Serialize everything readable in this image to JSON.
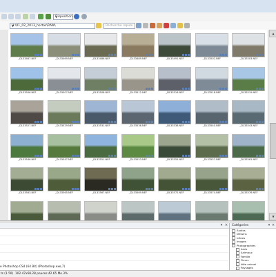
{
  "toolbar1": {
    "layout_label": "Disposition",
    "buttons": [
      "back-icon",
      "forward-icon",
      "up-icon",
      "refresh-icon",
      "folder-up-icon",
      "favorites-icon",
      "layout-icon",
      "help-icon",
      "info-icon"
    ]
  },
  "toolbar2": {
    "path": "H:\\01_02_2013_hortas\\RAW\\",
    "search_placeholder": "Recherche rapide"
  },
  "thumbnails": [
    {
      "label": "_DL33467.NEF",
      "c1": "#5f7d4a",
      "c2": "#a5c3e6"
    },
    {
      "label": "_DL33469.NEF",
      "c1": "#8b8f7a",
      "c2": "#d7dde4"
    },
    {
      "label": "_DL33486.NEF",
      "c1": "#6a6b52",
      "c2": "#e6e8ea"
    },
    {
      "label": "_DL33489.NEF",
      "c1": "#8a7a60",
      "c2": "#b8ad95"
    },
    {
      "label": "_DL33491.NEF",
      "c1": "#3e4a3a",
      "c2": "#b9c3c8"
    },
    {
      "label": "_DL33502.NEF",
      "c1": "#7d8a95",
      "c2": "#d8dfe6"
    },
    {
      "label": "_DL33503.NEF",
      "c1": "#7f7a6a",
      "c2": "#dfe2e5"
    },
    {
      "label": "_DL33506.NEF",
      "c1": "#4d6b3a",
      "c2": "#9fc2e8"
    },
    {
      "label": "_DL33507.NEF",
      "c1": "#8a8f95",
      "c2": "#e3e7eb"
    },
    {
      "label": "_DL33508.NEF",
      "c1": "#6e7f63",
      "c2": "#c5ced6"
    },
    {
      "label": "_DL33512.NEF",
      "c1": "#9a958a",
      "c2": "#dcdcd6"
    },
    {
      "label": "_DL33516.NEF",
      "c1": "#5d6068",
      "c2": "#b7bfca"
    },
    {
      "label": "_DL33518.NEF",
      "c1": "#7f8b96",
      "c2": "#d1d9e1"
    },
    {
      "label": "_DL33519.NEF",
      "c1": "#5a7d48",
      "c2": "#a8c6e6"
    },
    {
      "label": "_DL33527.NEF",
      "c1": "#4f4a45",
      "c2": "#a9a39a"
    },
    {
      "label": "_DL33529.NEF",
      "c1": "#6b7a5a",
      "c2": "#c4ccc0"
    },
    {
      "label": "_DL33531.NEF",
      "c1": "#4a5a6a",
      "c2": "#9eb6d3"
    },
    {
      "label": "_DL33536.NEF",
      "c1": "#5b6670",
      "c2": "#b8c6d6"
    },
    {
      "label": "_DL33538.NEF",
      "c1": "#3f5a78",
      "c2": "#8eb0d8"
    },
    {
      "label": "_DL33540.NEF",
      "c1": "#58646e",
      "c2": "#b0bdc9"
    },
    {
      "label": "_DL33543.NEF",
      "c1": "#596a72",
      "c2": "#a8b8c5"
    },
    {
      "label": "_DL33546.NEF",
      "c1": "#4c7a3e",
      "c2": "#8eb0d0"
    },
    {
      "label": "_DL33547.NEF",
      "c1": "#567a3d",
      "c2": "#a6c0a0"
    },
    {
      "label": "_DL33551.NEF",
      "c1": "#4a6a3f",
      "c2": "#8fb5de"
    },
    {
      "label": "_DL33553.NEF",
      "c1": "#5c8a42",
      "c2": "#a9c989"
    },
    {
      "label": "_DL33555.NEF",
      "c1": "#3a4a38",
      "c2": "#9ca58e"
    },
    {
      "label": "_DL33557.NEF",
      "c1": "#5b6b4c",
      "c2": "#b3c0a5"
    },
    {
      "label": "_DL33561.NEF",
      "c1": "#4a6a48",
      "c2": "#9fb4c8"
    },
    {
      "label": "_DL33563.NEF",
      "c1": "#3c4a34",
      "c2": "#a3ad93"
    },
    {
      "label": "_DL33565.NEF",
      "c1": "#4e5c3a",
      "c2": "#9aa88a"
    },
    {
      "label": "_DL33567.NEF",
      "c1": "#2a2a22",
      "c2": "#6f6a52"
    },
    {
      "label": "_DL33569.NEF",
      "c1": "#3f5236",
      "c2": "#8fa28a"
    },
    {
      "label": "_DL33572.NEF",
      "c1": "#445236",
      "c2": "#a1aa8e"
    },
    {
      "label": "_DL33574.NEF",
      "c1": "#48573a",
      "c2": "#97a38a"
    },
    {
      "label": "_DL33576.NEF",
      "c1": "#5a6242",
      "c2": "#a8ae94"
    },
    {
      "label": "_DL33578.NEF",
      "c1": "#4a5b3b",
      "c2": "#a0ab92"
    },
    {
      "label": "_DL33580.NEF",
      "c1": "#5e6a56",
      "c2": "#b7beb0"
    },
    {
      "label": "_DL33582.NEF",
      "c1": "#8a8c88",
      "c2": "#d0d2cc"
    },
    {
      "label": "_DL33584.NEF",
      "c1": "#5d6b6a",
      "c2": "#bcc6c4"
    },
    {
      "label": "_DL33586.NEF",
      "c1": "#607280",
      "c2": "#bccad6"
    },
    {
      "label": "",
      "c1": "#6b7a70",
      "c2": "#b5c1bc"
    },
    {
      "label": "",
      "c1": "#4d6a55",
      "c2": "#a8bfb0"
    },
    {
      "label": "",
      "c1": "",
      "c2": "",
      "doc": true
    },
    {
      "label": "",
      "c1": "",
      "c2": "",
      "doc": true
    }
  ],
  "labels_visible": [
    "_DL33467.NEF",
    "_DL33469.NEF",
    "_DL33486.NEF",
    "_DL33489.NEF",
    "_DL33491.NEF",
    "_DL33502.NEF",
    "_DL33503.NEF"
  ],
  "categories": {
    "title": "Catégories",
    "items": [
      "Audios",
      "Dessins",
      "Icônes",
      "Images",
      "Photographies",
      "Amis",
      "Animaux",
      "Famille",
      "Fleurs",
      "Idée animal",
      "Paysages"
    ]
  },
  "bottom_text": "e Photoshop CS4 (64 Bit) (Photoshop.exe,7)",
  "status": {
    "left": "ts (1.50)",
    "middle": "102.47x68.28 pouces  42.65 Mo  3%"
  },
  "colors": {
    "selection": "#cfe2f7",
    "titlebar": "#d7e3f1",
    "badge": "#5a7fb0"
  }
}
